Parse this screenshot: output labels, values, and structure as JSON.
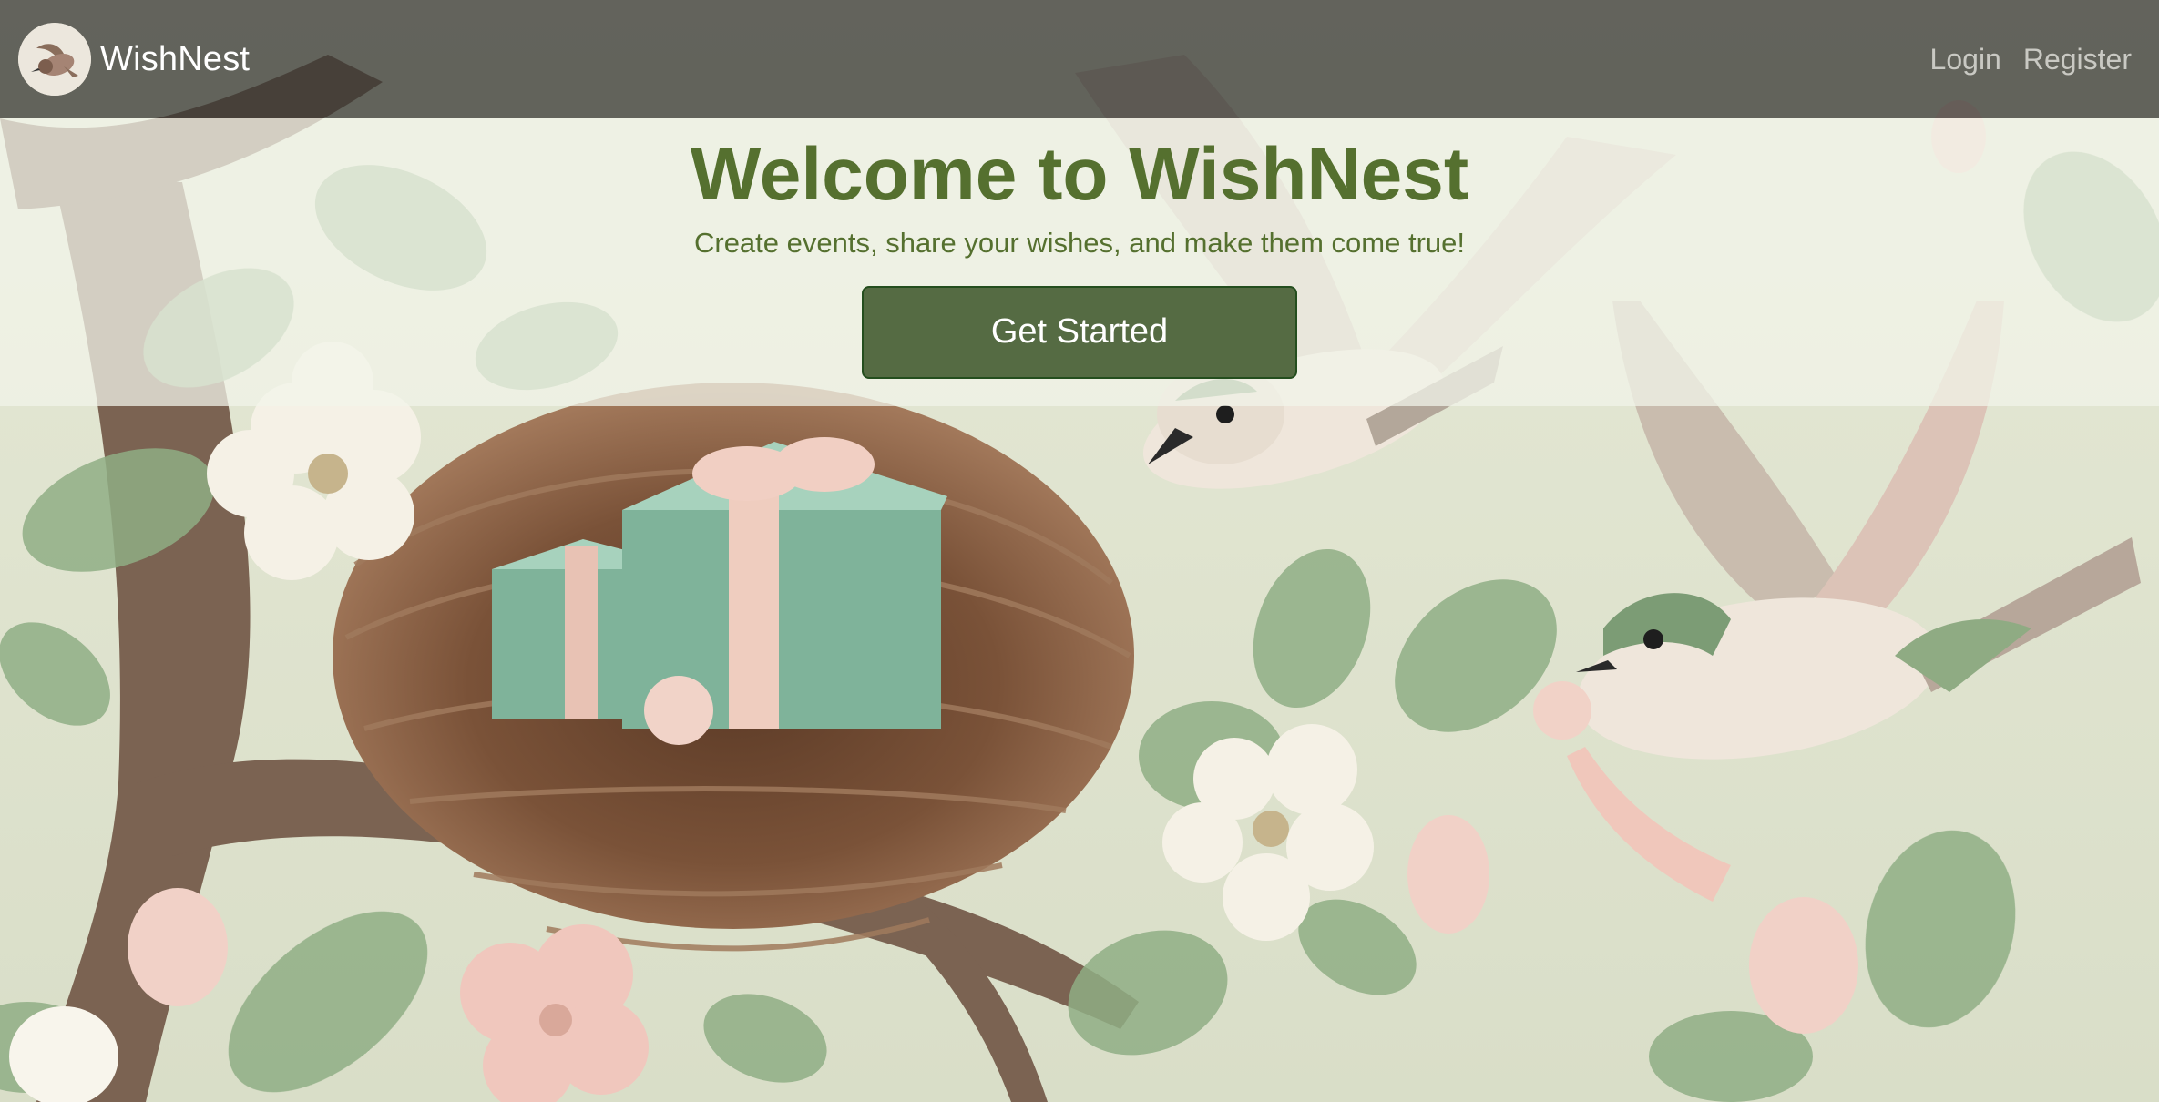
{
  "navbar": {
    "brand": "WishNest",
    "logo_icon": "bird-logo-icon",
    "links": {
      "login": "Login",
      "register": "Register"
    }
  },
  "hero": {
    "title": "Welcome to WishNest",
    "subtitle": "Create events, share your wishes, and make them come true!",
    "cta_label": "Get Started"
  },
  "background": {
    "description_icons": [
      "nest-with-gifts-icon",
      "flying-bird-icon",
      "blossom-icon",
      "leaf-icon"
    ]
  },
  "colors": {
    "accent": "#55702f",
    "button": "#556b43",
    "button_border": "#244e1e",
    "navbar": "#343430"
  }
}
